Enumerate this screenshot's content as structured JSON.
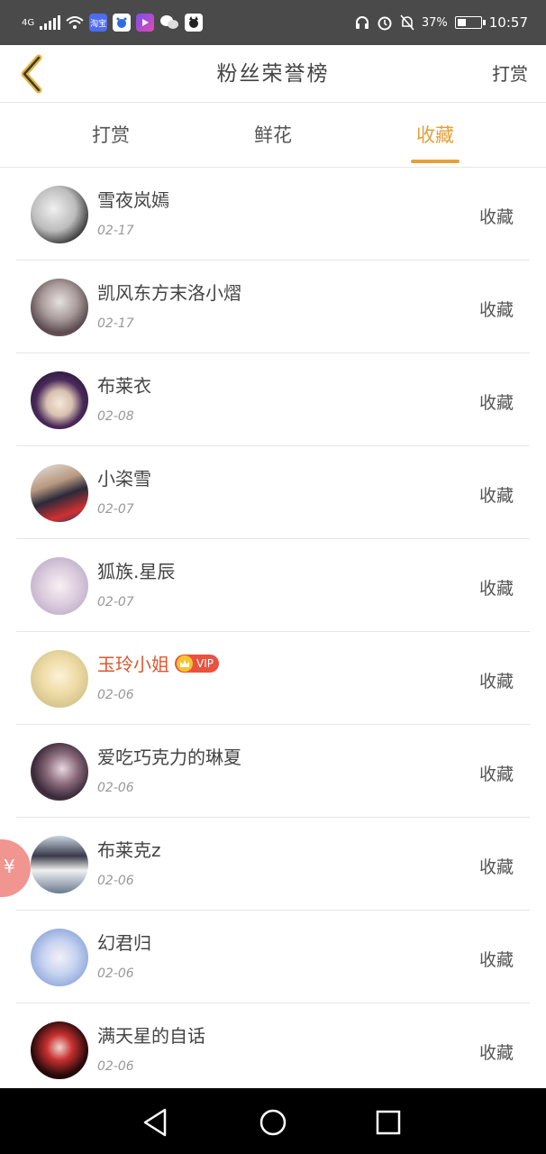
{
  "status_bar": {
    "network": "4G",
    "app_badge_label": "淘宝",
    "battery": "37%",
    "time": "10:57"
  },
  "header": {
    "title": "粉丝荣誉榜",
    "right_action": "打赏"
  },
  "tabs": [
    {
      "label": "打赏",
      "active": false
    },
    {
      "label": "鲜花",
      "active": false
    },
    {
      "label": "收藏",
      "active": true
    }
  ],
  "colors": {
    "accent": "#e6a03a",
    "vip_name": "#e0552c",
    "vip_badge": "#e8523f",
    "status_bar": "#4a4a4a"
  },
  "fans": [
    {
      "name": "雪夜岚嫣",
      "date": "02-17",
      "action": "收藏"
    },
    {
      "name": "凯风东方末洛小熠",
      "date": "02-17",
      "action": "收藏"
    },
    {
      "name": "布莱衣",
      "date": "02-08",
      "action": "收藏"
    },
    {
      "name": "小栥雪",
      "date": "02-07",
      "action": "收藏"
    },
    {
      "name": "狐族.星辰",
      "date": "02-07",
      "action": "收藏"
    },
    {
      "name": "玉玲小姐",
      "date": "02-06",
      "action": "收藏",
      "vip": "VIP"
    },
    {
      "name": "爱吃巧克力的琳夏",
      "date": "02-06",
      "action": "收藏"
    },
    {
      "name": "布莱克z",
      "date": "02-06",
      "action": "收藏"
    },
    {
      "name": "幻君归",
      "date": "02-06",
      "action": "收藏"
    },
    {
      "name": "满天星的自话",
      "date": "02-06",
      "action": "收藏"
    }
  ],
  "floating_button": {
    "icon": "yen-icon",
    "symbol": "¥"
  },
  "system_nav": [
    "back-icon",
    "home-icon",
    "recents-icon"
  ]
}
